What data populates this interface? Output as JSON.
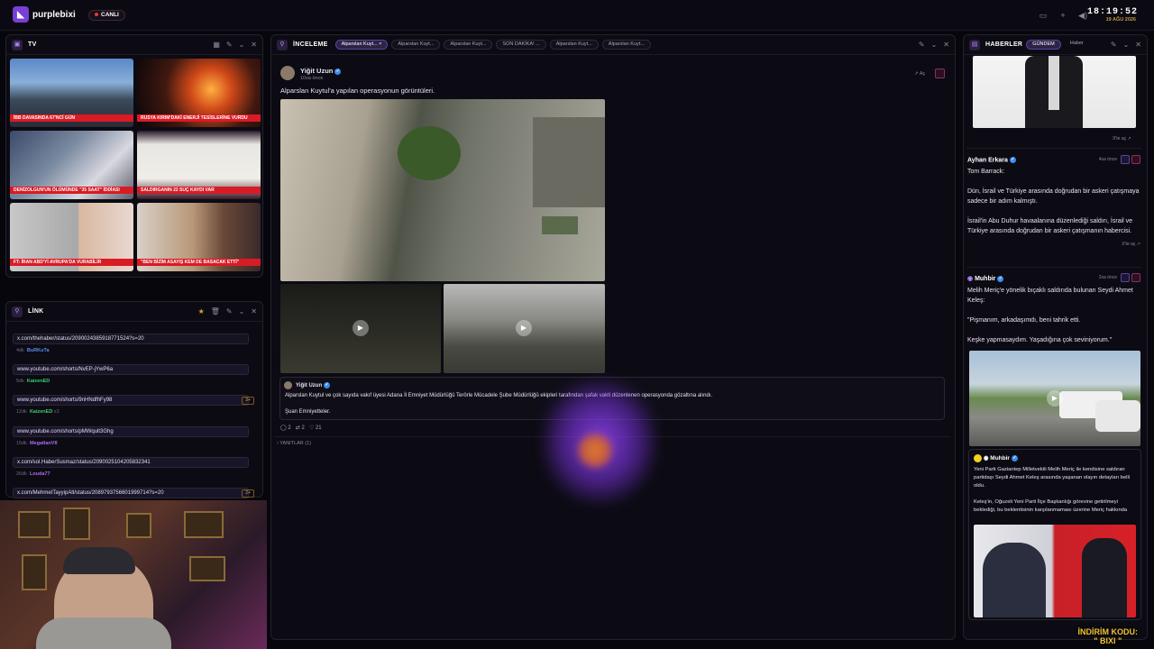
{
  "topbar": {
    "brand": "purplebixi",
    "live_label": "CANLI",
    "clock": "18:19:52",
    "date": "19 AĞU 2026"
  },
  "tv": {
    "title": "TV",
    "captions": [
      "İBB DAVASINDA 67'NCİ GÜN",
      "RUSYA KIRIM'DAKİ ENERJİ TESİSLERİNE VURDU",
      "DENİZOLGUN'UN ÖLÜMÜNDE \"35 SAAT\" İDDİASI",
      "SALDIRGANIN 22 SUÇ KAYDI VAR",
      "FT: İRAN ABD'Yİ AVRUPA'DA VURABİLİR",
      "\"BEN BİZİM ASAYIŞ KEM DE BASACAK ETTİ\""
    ]
  },
  "link": {
    "title": "LİNK",
    "items": [
      {
        "url": "x.com/thehaber/status/2090024385918771524?s=20",
        "age": "4dk",
        "user": "BuRKuTa",
        "color": "#5a8cf0",
        "badge": ""
      },
      {
        "url": "www.youtube.com/shorts/NvEP-jYwP6a",
        "age": "5dk",
        "user": "KaizenED",
        "color": "#3ad06a",
        "badge": ""
      },
      {
        "url": "www.youtube.com/shorts/9nHNdfhFy98",
        "age": "12dk",
        "user": "KaizenED",
        "color": "#3ad06a",
        "badge": "3+",
        "extra": "x3"
      },
      {
        "url": "www.youtube.com/shorts/pMWqult3Ghg",
        "age": "15dk",
        "user": "MegatlanVII",
        "color": "#b06af0",
        "badge": ""
      },
      {
        "url": "x.com/sol.HaberSusmaz/status/2090025104205832341",
        "age": "26dk",
        "user": "Louda77",
        "color": "#b06af0",
        "badge": ""
      },
      {
        "url": "x.com/MehmetTayyipAlt/status/2089793756601999714?s=20",
        "age": "",
        "user": "",
        "color": "#b06af0",
        "badge": "2+"
      }
    ]
  },
  "inceleme": {
    "title": "İNCELEME",
    "tabs": [
      "Alparslan Kuyt...",
      "Alparslan Kuyt...",
      "Alparslan Kuyt...",
      "SON DAKİKA! ...",
      "Alparslan Kuyt...",
      "Alparslan Kuyt..."
    ],
    "author": "Yiğit Uzun",
    "time": "10sa önce",
    "open_label": "Aç",
    "text": "Alparslan Kuytul'a yapılan operasyonun görüntüleri.",
    "quote_author": "Yiğit Uzun",
    "quote_text": "Alparslan Kuytul ve çok sayıda vakıf üyesi Adana İl Emniyet Müdürlüğü Terörle Mücadele Şube Müdürlüğü ekipleri tarafından şafak vakti düzenlenen operasyonda gözaltına alındı.",
    "quote_text2": "Şuan Emniyetteler.",
    "replies": "2",
    "retweets": "2",
    "likes": "21",
    "thread_label": "YANITLAR (1)"
  },
  "haberler": {
    "title": "HABERLER",
    "tab_active": "GÜNDEM",
    "tab_other": "Haber",
    "open_x": "X'te aç",
    "cards": [
      {
        "name": "Ayhan Erkara",
        "time": "4sa önce",
        "lines": [
          "Tom Barrack:",
          "",
          "Dün, İsrail ve Türkiye arasında doğrudan bir askeri çatışmaya sadece bir adım kalmıştı.",
          "",
          "İsrail'in Abu Duhur havaalanına düzenlediği saldırı, İsrail ve Türkiye arasında doğrudan bir askeri çatışmanın habercisi."
        ]
      },
      {
        "name": "Muhbir",
        "time": "2sa önce",
        "lines": [
          "Melih Meriç'e yönelik bıçaklı saldırıda bulunan Seydi Ahmet Keleş:",
          "",
          "\"Pişmanım, arkadaşımdı, beni tahrik etti.",
          "",
          "Keşke yapmasaydım. Yaşadığına çok seviniyorum.\""
        ]
      },
      {
        "name": "Muhbir",
        "time": "",
        "lines": [
          "Yeni Parti Gaziantep Milletvekili Melih Meriç ile kendisine saldıran partidaşı Seydi Ahmet Keleş arasında yaşanan olayın detayları belli oldu.",
          "",
          "Keleş'in, Oğuzeli Yeni Parti İlçe Başkanlığı görevine getirilmeyi beklediği, bu beklentisinin karşılanmaması üzerine Meriç hakkında"
        ]
      }
    ]
  },
  "promo": {
    "line1": "İNDİRİM KODU:",
    "line2": "\" BIXI \""
  },
  "colors": {
    "accent": "#7a3fd6",
    "live": "#e33333",
    "promo": "#f2c230"
  }
}
